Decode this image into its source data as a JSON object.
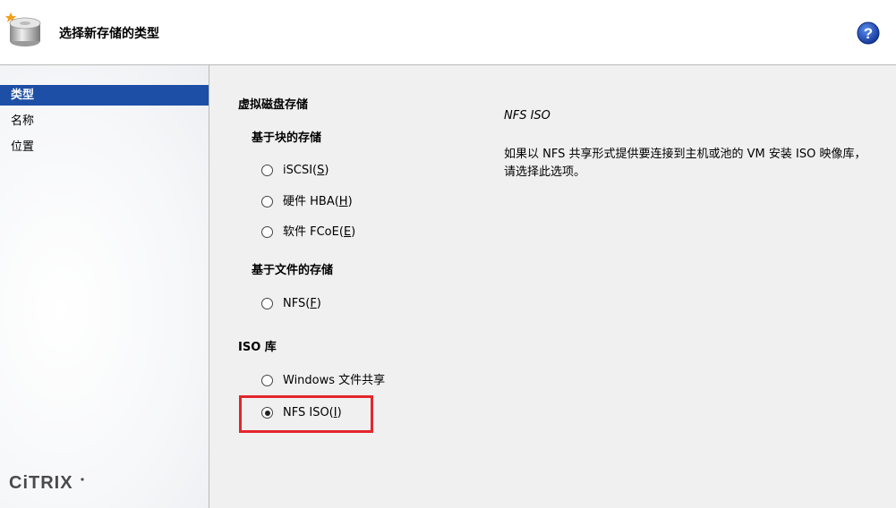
{
  "header": {
    "title": "选择新存储的类型",
    "icon": "storage-drive-icon",
    "help_icon": "help-icon"
  },
  "sidebar": {
    "items": [
      {
        "label": "类型",
        "active": true
      },
      {
        "label": "名称",
        "active": false
      },
      {
        "label": "位置",
        "active": false
      }
    ],
    "logo_text": "CiTRIX"
  },
  "main": {
    "section_virtual_disk": "虚拟磁盘存储",
    "subsection_block": "基于块的存储",
    "options_block": [
      {
        "label": "iSCSI(",
        "mnemonic": "S",
        "suffix": ")"
      },
      {
        "label": "硬件 HBA(",
        "mnemonic": "H",
        "suffix": ")"
      },
      {
        "label": "软件 FCoE(",
        "mnemonic": "E",
        "suffix": ")"
      }
    ],
    "subsection_file": "基于文件的存储",
    "options_file": [
      {
        "label": "NFS(",
        "mnemonic": "F",
        "suffix": ")"
      }
    ],
    "section_iso": "ISO 库",
    "options_iso": [
      {
        "label": "Windows 文件共享",
        "mnemonic": "",
        "suffix": ""
      },
      {
        "label": "NFS ISO(",
        "mnemonic": "I",
        "suffix": ")",
        "checked": true
      }
    ],
    "description": {
      "title": "NFS ISO",
      "body": "如果以 NFS 共享形式提供要连接到主机或池的 VM 安装 ISO 映像库，请选择此选项。"
    }
  },
  "colors": {
    "accent": "#1d4fa6",
    "highlight": "#e3262d",
    "panel_bg": "#f0f0f0"
  }
}
